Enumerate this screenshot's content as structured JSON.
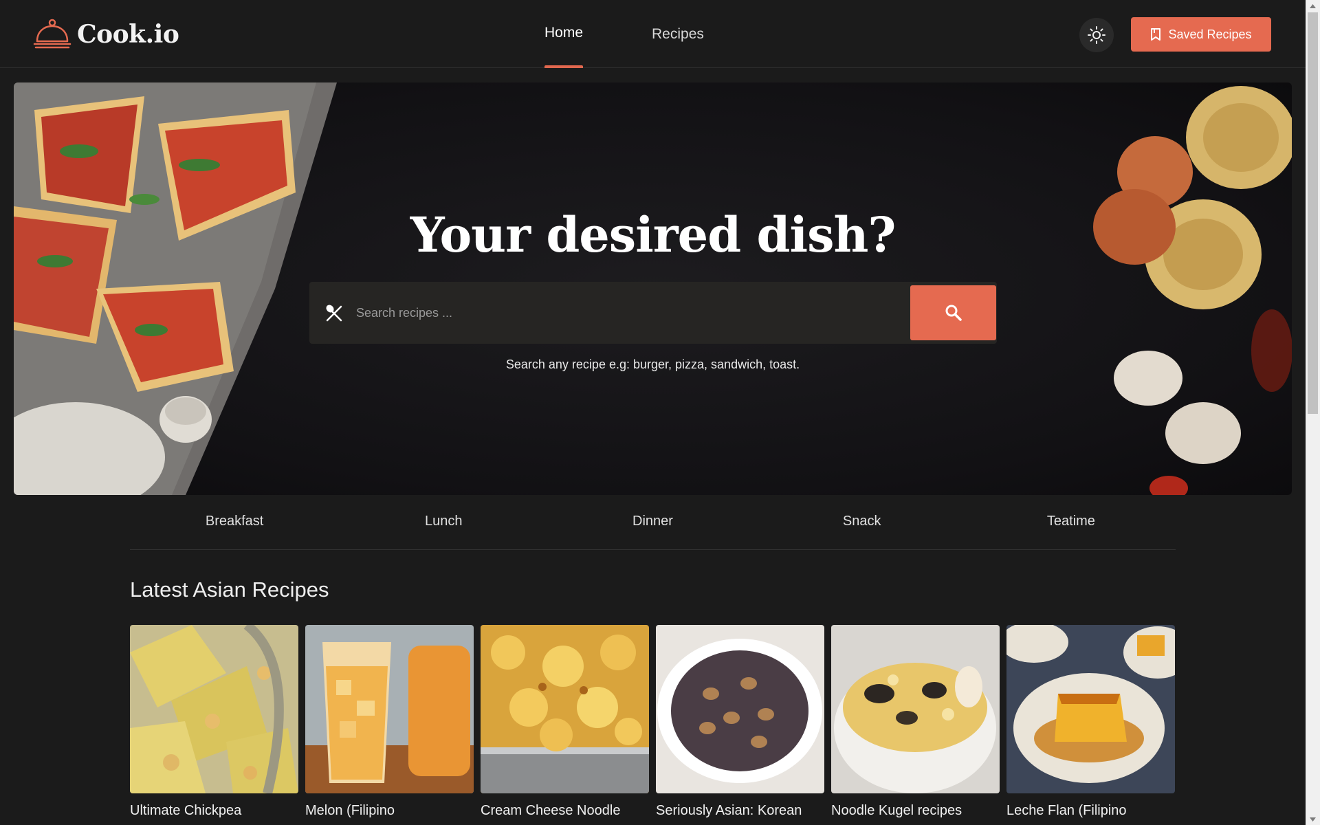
{
  "header": {
    "logo_text": "Cook.io",
    "nav": [
      {
        "label": "Home",
        "active": true
      },
      {
        "label": "Recipes",
        "active": false
      }
    ],
    "theme_toggle_icon": "sun-icon",
    "saved_button": {
      "label": "Saved Recipes",
      "icon": "bookmark-icon"
    }
  },
  "hero": {
    "title": "Your desired dish?",
    "search": {
      "placeholder": "Search recipes ...",
      "value": "",
      "icon": "utensils-icon",
      "button_icon": "search-icon"
    },
    "hint": "Search any recipe e.g: burger, pizza, sandwich, toast."
  },
  "categories": [
    "Breakfast",
    "Lunch",
    "Dinner",
    "Snack",
    "Teatime"
  ],
  "latest": {
    "title": "Latest Asian Recipes",
    "recipes": [
      {
        "title": "Ultimate Chickpea"
      },
      {
        "title": "Melon (Filipino"
      },
      {
        "title": "Cream Cheese Noodle"
      },
      {
        "title": "Seriously Asian: Korean"
      },
      {
        "title": "Noodle Kugel recipes"
      },
      {
        "title": "Leche Flan (Filipino"
      }
    ]
  },
  "colors": {
    "accent": "#e56a50",
    "background": "#1b1b1b",
    "hero_background": "#121114"
  }
}
